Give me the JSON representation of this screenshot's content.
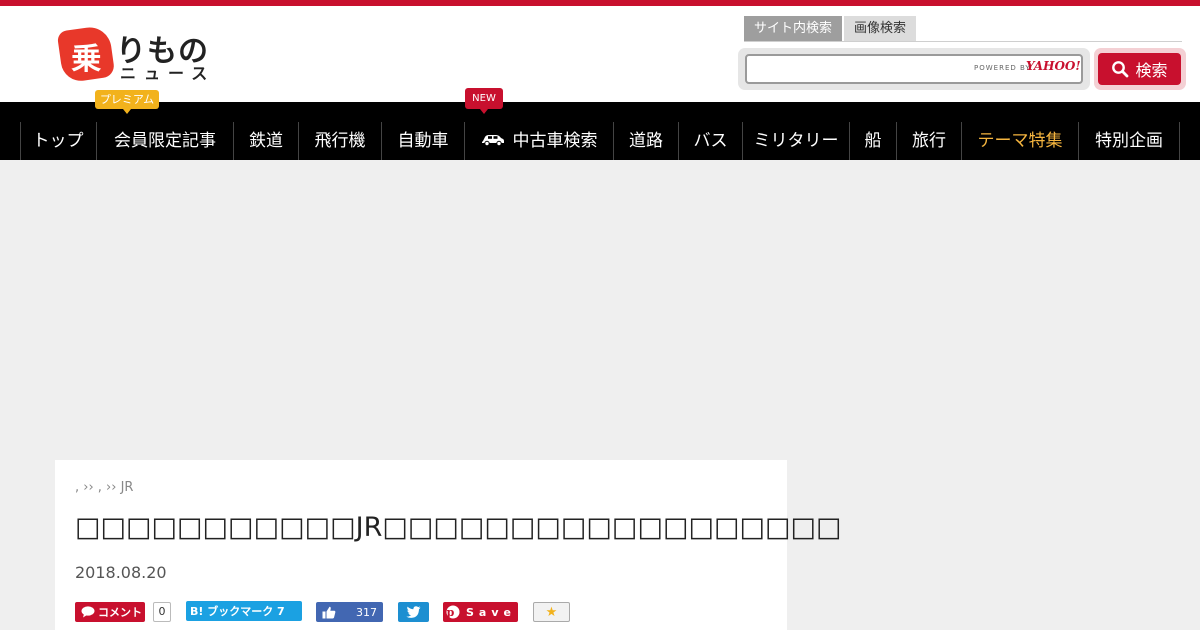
{
  "logo": {
    "mark": "乗",
    "top": "りもの",
    "bottom": "ニュース"
  },
  "search": {
    "tabs": [
      {
        "label": "サイト内検索",
        "active": true
      },
      {
        "label": "画像検索",
        "active": false
      }
    ],
    "input_value": "",
    "powered_by": "POWERED BY",
    "provider": "YAHOO!",
    "button_label": "検索"
  },
  "badges": {
    "premium": "プレミアム",
    "new": "NEW"
  },
  "nav": {
    "items": [
      {
        "label": "トップ"
      },
      {
        "label": "会員限定記事"
      },
      {
        "label": "鉄道"
      },
      {
        "label": "飛行機"
      },
      {
        "label": "自動車"
      },
      {
        "label": "中古車検索",
        "icon": "car-icon"
      },
      {
        "label": "道路"
      },
      {
        "label": "バス"
      },
      {
        "label": "ミリタリー"
      },
      {
        "label": "船"
      },
      {
        "label": "旅行"
      },
      {
        "label": "テーマ特集",
        "highlight": true
      },
      {
        "label": "特別企画"
      }
    ]
  },
  "article": {
    "breadcrumb": ", ›› , ›› JR",
    "title": "□□□□□□□□□□□JR□□□□□□□□□□□□□□□□□□",
    "date": "2018.08.20"
  },
  "share": {
    "comment_label": "コメント",
    "comment_count": "0",
    "hatena_label": "B! ブックマーク 7",
    "facebook_count": "317",
    "pinterest_label": "Save"
  },
  "colors": {
    "brand_red": "#c8102e",
    "theme_orange": "#f5b53f",
    "premium_yellow": "#f2b21c"
  }
}
